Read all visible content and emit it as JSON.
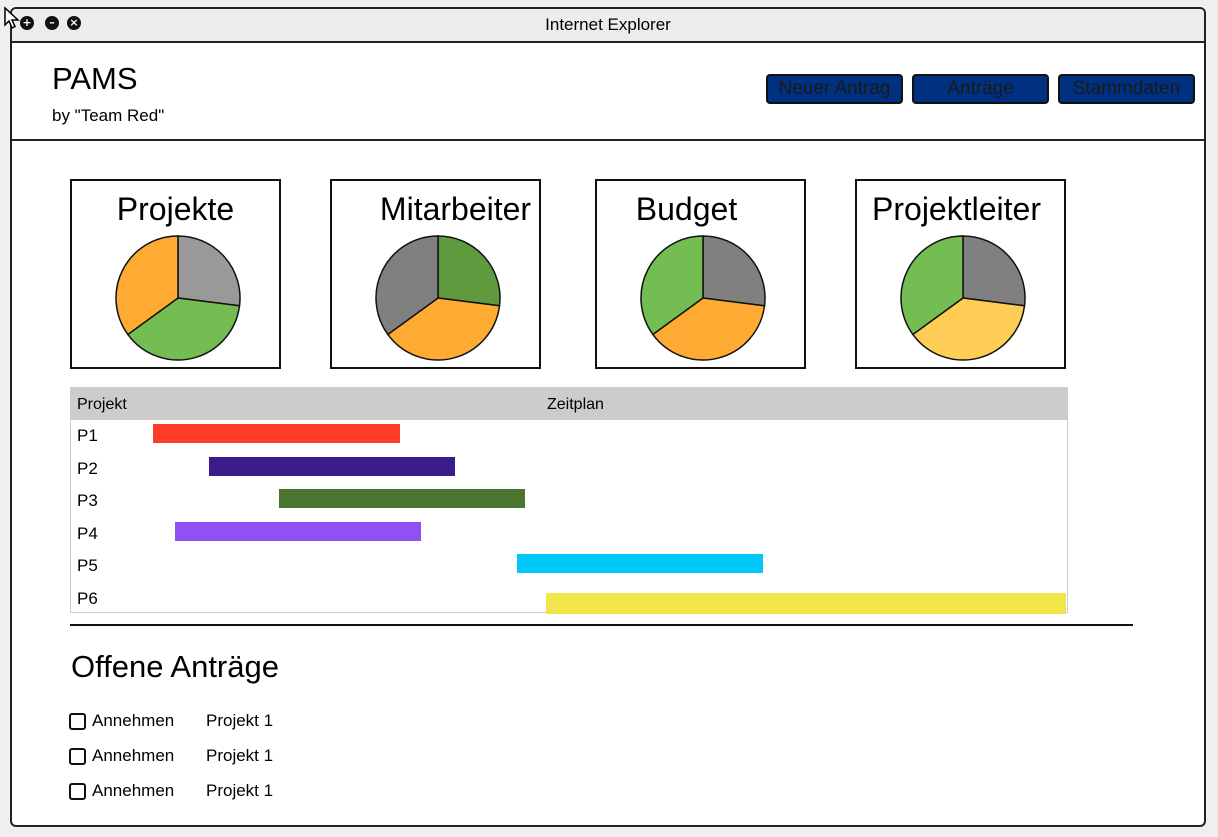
{
  "window": {
    "title": "Internet Explorer"
  },
  "header": {
    "title": "PAMS",
    "subtitle": "by \"Team Red\"",
    "nav": [
      "Neuer Antrag",
      "Anträge",
      "Stammdaten"
    ]
  },
  "cards": [
    {
      "title": "Projekte",
      "slices": [
        {
          "value": 27,
          "color": "#999999"
        },
        {
          "value": 38,
          "color": "#74bd52"
        },
        {
          "value": 35,
          "color": "#ffaa33"
        }
      ]
    },
    {
      "title": "Mitarbeiter",
      "slices": [
        {
          "value": 27,
          "color": "#609a40"
        },
        {
          "value": 38,
          "color": "#ffaa33"
        },
        {
          "value": 35,
          "color": "#808080"
        }
      ]
    },
    {
      "title": "Budget",
      "slices": [
        {
          "value": 27,
          "color": "#808080"
        },
        {
          "value": 38,
          "color": "#ffaa33"
        },
        {
          "value": 35,
          "color": "#74bd52"
        }
      ]
    },
    {
      "title": "Projektleiter",
      "slices": [
        {
          "value": 27,
          "color": "#808080"
        },
        {
          "value": 38,
          "color": "#ffcc55"
        },
        {
          "value": 35,
          "color": "#74bd52"
        }
      ]
    }
  ],
  "gantt": {
    "headers": [
      "Projekt",
      "Zeitplan"
    ],
    "rows": [
      {
        "label": "P1",
        "start": 0.0828,
        "end": 0.3303,
        "color": "#ff3c28"
      },
      {
        "label": "P2",
        "start": 0.1382,
        "end": 0.3856,
        "color": "#3b1c8c"
      },
      {
        "label": "P3",
        "start": 0.2087,
        "end": 0.4562,
        "color": "#4b7530"
      },
      {
        "label": "P4",
        "start": 0.1044,
        "end": 0.3519,
        "color": "#8e52f2"
      },
      {
        "label": "P5",
        "start": 0.4474,
        "end": 0.6949,
        "color": "#00c8f6"
      },
      {
        "label": "P6",
        "start": 0.4766,
        "end": 0.999,
        "color": "#f2e54b"
      }
    ]
  },
  "requests": {
    "title": "Offene Anträge",
    "items": [
      {
        "label": "Annehmen",
        "project": "Projekt 1"
      },
      {
        "label": "Annehmen",
        "project": "Projekt 1"
      },
      {
        "label": "Annehmen",
        "project": "Projekt 1"
      }
    ]
  }
}
